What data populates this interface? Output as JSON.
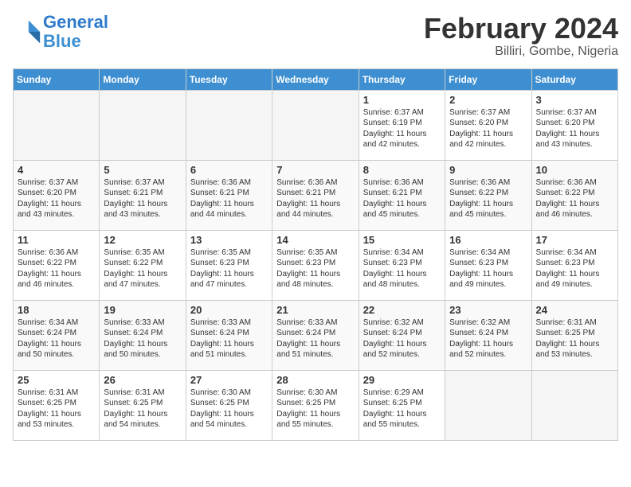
{
  "header": {
    "logo_line1": "General",
    "logo_line2": "Blue",
    "month_title": "February 2024",
    "location": "Billiri, Gombe, Nigeria"
  },
  "weekdays": [
    "Sunday",
    "Monday",
    "Tuesday",
    "Wednesday",
    "Thursday",
    "Friday",
    "Saturday"
  ],
  "weeks": [
    [
      {
        "day": "",
        "sunrise": "",
        "sunset": "",
        "daylight": "",
        "empty": true
      },
      {
        "day": "",
        "sunrise": "",
        "sunset": "",
        "daylight": "",
        "empty": true
      },
      {
        "day": "",
        "sunrise": "",
        "sunset": "",
        "daylight": "",
        "empty": true
      },
      {
        "day": "",
        "sunrise": "",
        "sunset": "",
        "daylight": "",
        "empty": true
      },
      {
        "day": "1",
        "sunrise": "Sunrise: 6:37 AM",
        "sunset": "Sunset: 6:19 PM",
        "daylight": "Daylight: 11 hours and 42 minutes.",
        "empty": false
      },
      {
        "day": "2",
        "sunrise": "Sunrise: 6:37 AM",
        "sunset": "Sunset: 6:20 PM",
        "daylight": "Daylight: 11 hours and 42 minutes.",
        "empty": false
      },
      {
        "day": "3",
        "sunrise": "Sunrise: 6:37 AM",
        "sunset": "Sunset: 6:20 PM",
        "daylight": "Daylight: 11 hours and 43 minutes.",
        "empty": false
      }
    ],
    [
      {
        "day": "4",
        "sunrise": "Sunrise: 6:37 AM",
        "sunset": "Sunset: 6:20 PM",
        "daylight": "Daylight: 11 hours and 43 minutes.",
        "empty": false
      },
      {
        "day": "5",
        "sunrise": "Sunrise: 6:37 AM",
        "sunset": "Sunset: 6:21 PM",
        "daylight": "Daylight: 11 hours and 43 minutes.",
        "empty": false
      },
      {
        "day": "6",
        "sunrise": "Sunrise: 6:36 AM",
        "sunset": "Sunset: 6:21 PM",
        "daylight": "Daylight: 11 hours and 44 minutes.",
        "empty": false
      },
      {
        "day": "7",
        "sunrise": "Sunrise: 6:36 AM",
        "sunset": "Sunset: 6:21 PM",
        "daylight": "Daylight: 11 hours and 44 minutes.",
        "empty": false
      },
      {
        "day": "8",
        "sunrise": "Sunrise: 6:36 AM",
        "sunset": "Sunset: 6:21 PM",
        "daylight": "Daylight: 11 hours and 45 minutes.",
        "empty": false
      },
      {
        "day": "9",
        "sunrise": "Sunrise: 6:36 AM",
        "sunset": "Sunset: 6:22 PM",
        "daylight": "Daylight: 11 hours and 45 minutes.",
        "empty": false
      },
      {
        "day": "10",
        "sunrise": "Sunrise: 6:36 AM",
        "sunset": "Sunset: 6:22 PM",
        "daylight": "Daylight: 11 hours and 46 minutes.",
        "empty": false
      }
    ],
    [
      {
        "day": "11",
        "sunrise": "Sunrise: 6:36 AM",
        "sunset": "Sunset: 6:22 PM",
        "daylight": "Daylight: 11 hours and 46 minutes.",
        "empty": false
      },
      {
        "day": "12",
        "sunrise": "Sunrise: 6:35 AM",
        "sunset": "Sunset: 6:22 PM",
        "daylight": "Daylight: 11 hours and 47 minutes.",
        "empty": false
      },
      {
        "day": "13",
        "sunrise": "Sunrise: 6:35 AM",
        "sunset": "Sunset: 6:23 PM",
        "daylight": "Daylight: 11 hours and 47 minutes.",
        "empty": false
      },
      {
        "day": "14",
        "sunrise": "Sunrise: 6:35 AM",
        "sunset": "Sunset: 6:23 PM",
        "daylight": "Daylight: 11 hours and 48 minutes.",
        "empty": false
      },
      {
        "day": "15",
        "sunrise": "Sunrise: 6:34 AM",
        "sunset": "Sunset: 6:23 PM",
        "daylight": "Daylight: 11 hours and 48 minutes.",
        "empty": false
      },
      {
        "day": "16",
        "sunrise": "Sunrise: 6:34 AM",
        "sunset": "Sunset: 6:23 PM",
        "daylight": "Daylight: 11 hours and 49 minutes.",
        "empty": false
      },
      {
        "day": "17",
        "sunrise": "Sunrise: 6:34 AM",
        "sunset": "Sunset: 6:23 PM",
        "daylight": "Daylight: 11 hours and 49 minutes.",
        "empty": false
      }
    ],
    [
      {
        "day": "18",
        "sunrise": "Sunrise: 6:34 AM",
        "sunset": "Sunset: 6:24 PM",
        "daylight": "Daylight: 11 hours and 50 minutes.",
        "empty": false
      },
      {
        "day": "19",
        "sunrise": "Sunrise: 6:33 AM",
        "sunset": "Sunset: 6:24 PM",
        "daylight": "Daylight: 11 hours and 50 minutes.",
        "empty": false
      },
      {
        "day": "20",
        "sunrise": "Sunrise: 6:33 AM",
        "sunset": "Sunset: 6:24 PM",
        "daylight": "Daylight: 11 hours and 51 minutes.",
        "empty": false
      },
      {
        "day": "21",
        "sunrise": "Sunrise: 6:33 AM",
        "sunset": "Sunset: 6:24 PM",
        "daylight": "Daylight: 11 hours and 51 minutes.",
        "empty": false
      },
      {
        "day": "22",
        "sunrise": "Sunrise: 6:32 AM",
        "sunset": "Sunset: 6:24 PM",
        "daylight": "Daylight: 11 hours and 52 minutes.",
        "empty": false
      },
      {
        "day": "23",
        "sunrise": "Sunrise: 6:32 AM",
        "sunset": "Sunset: 6:24 PM",
        "daylight": "Daylight: 11 hours and 52 minutes.",
        "empty": false
      },
      {
        "day": "24",
        "sunrise": "Sunrise: 6:31 AM",
        "sunset": "Sunset: 6:25 PM",
        "daylight": "Daylight: 11 hours and 53 minutes.",
        "empty": false
      }
    ],
    [
      {
        "day": "25",
        "sunrise": "Sunrise: 6:31 AM",
        "sunset": "Sunset: 6:25 PM",
        "daylight": "Daylight: 11 hours and 53 minutes.",
        "empty": false
      },
      {
        "day": "26",
        "sunrise": "Sunrise: 6:31 AM",
        "sunset": "Sunset: 6:25 PM",
        "daylight": "Daylight: 11 hours and 54 minutes.",
        "empty": false
      },
      {
        "day": "27",
        "sunrise": "Sunrise: 6:30 AM",
        "sunset": "Sunset: 6:25 PM",
        "daylight": "Daylight: 11 hours and 54 minutes.",
        "empty": false
      },
      {
        "day": "28",
        "sunrise": "Sunrise: 6:30 AM",
        "sunset": "Sunset: 6:25 PM",
        "daylight": "Daylight: 11 hours and 55 minutes.",
        "empty": false
      },
      {
        "day": "29",
        "sunrise": "Sunrise: 6:29 AM",
        "sunset": "Sunset: 6:25 PM",
        "daylight": "Daylight: 11 hours and 55 minutes.",
        "empty": false
      },
      {
        "day": "",
        "sunrise": "",
        "sunset": "",
        "daylight": "",
        "empty": true
      },
      {
        "day": "",
        "sunrise": "",
        "sunset": "",
        "daylight": "",
        "empty": true
      }
    ]
  ]
}
